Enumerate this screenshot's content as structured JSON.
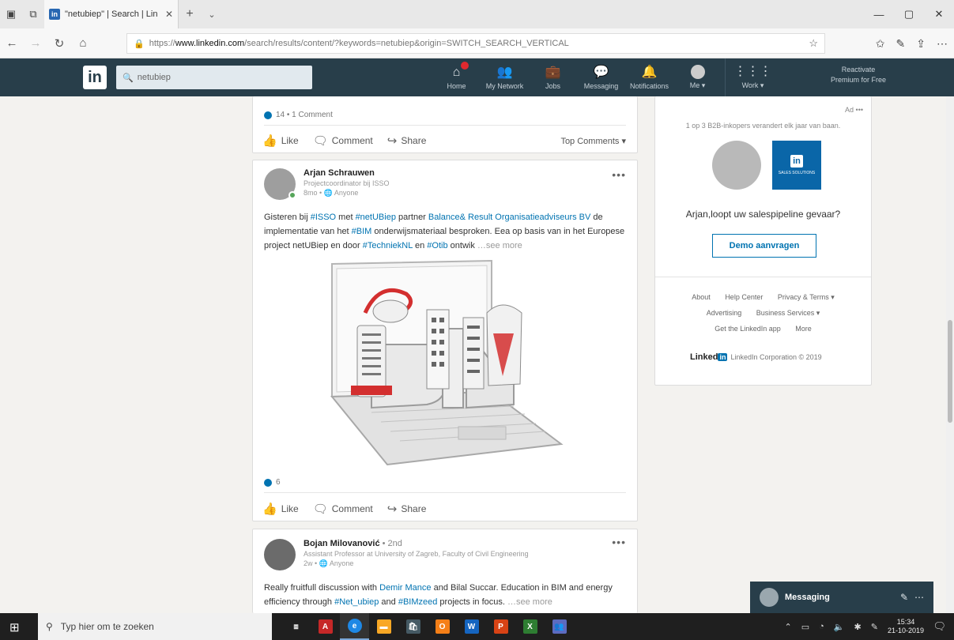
{
  "browser": {
    "tab_title": "\"netubiep\" | Search | Lin",
    "url_prefix": "https://",
    "url_domain": "www.linkedin.com",
    "url_path": "/search/results/content/?keywords=netubiep&origin=SWITCH_SEARCH_VERTICAL"
  },
  "header": {
    "logo": "in",
    "search_value": "netubiep",
    "nav": [
      {
        "label": "Home",
        "icon": "home-icon"
      },
      {
        "label": "My Network",
        "icon": "network-icon"
      },
      {
        "label": "Jobs",
        "icon": "jobs-icon"
      },
      {
        "label": "Messaging",
        "icon": "messaging-icon"
      },
      {
        "label": "Notifications",
        "icon": "bell-icon"
      },
      {
        "label": "Me ▾",
        "icon": "avatar"
      },
      {
        "label": "Work ▾",
        "icon": "grid-icon"
      }
    ],
    "premium_line1": "Reactivate",
    "premium_line2": "Premium for Free"
  },
  "post_top": {
    "reactions": "14 • 1 Comment",
    "like": "Like",
    "comment": "Comment",
    "share": "Share",
    "sort": "Top Comments ▾"
  },
  "post_main": {
    "author": "Arjan Schrauwen",
    "headline": "Projectcoordinator bij ISSO",
    "time": "8mo • 🌐 Anyone",
    "menu": "•••",
    "text_1": "Gisteren bij ",
    "tag_isso": "#ISSO",
    "text_2": " met ",
    "tag_netubiep": "#netUBiep",
    "text_3": " partner ",
    "tag_balance": "Balance& Result Organisatieadviseurs BV",
    "text_4": " de implementatie van het ",
    "tag_bim": "#BIM",
    "text_5": " onderwijsmateriaal besproken. Eea op basis van in het Europese project netUBiep en door ",
    "tag_techniek": "#TechniekNL",
    "text_6": " en ",
    "tag_otib": "#Otib",
    "text_7": " ontwik",
    "see_more": " …see more",
    "reactions": "6",
    "like": "Like",
    "comment": "Comment",
    "share": "Share"
  },
  "post_next": {
    "author": "Bojan Milovanović",
    "degree": " • 2nd",
    "headline": "Assistant Professor at University of Zagreb, Faculty of Civil Engineering",
    "time": "2w • 🌐 Anyone",
    "menu": "•••",
    "text_1": "Really fruitfull discussion with ",
    "tag_demir": "Demir Mance",
    "text_2": " and Bilal Succar. Education in BIM and energy efficiency through ",
    "tag_net": "#Net_ubiep",
    "text_3": " and ",
    "tag_bimzeed": "#BIMzeed",
    "text_4": " projects in focus.",
    "see_more": " …see more"
  },
  "ad": {
    "label": "Ad",
    "menu": "•••",
    "subtitle": "1 op 3 B2B-inkopers verandert elk jaar van baan.",
    "logo_text": "in",
    "logo_sub": "SALES SOLUTIONS",
    "title": "Arjan,loopt uw salespipeline gevaar?",
    "button": "Demo aanvragen"
  },
  "footer": {
    "row1": [
      "About",
      "Help Center",
      "Privacy & Terms ▾"
    ],
    "row2": [
      "Advertising",
      "Business Services ▾"
    ],
    "row3": [
      "Get the LinkedIn app",
      "More"
    ],
    "brand": "Linked",
    "brand_in": "in",
    "copyright": "LinkedIn Corporation © 2019"
  },
  "messaging": {
    "label": "Messaging"
  },
  "taskbar": {
    "search_placeholder": "Typ hier om te zoeken",
    "time": "15:34",
    "date": "21-10-2019"
  },
  "colors": {
    "linkedin_header": "#283e4a",
    "link_blue": "#0073b1",
    "page_bg": "#f3f2ef"
  }
}
